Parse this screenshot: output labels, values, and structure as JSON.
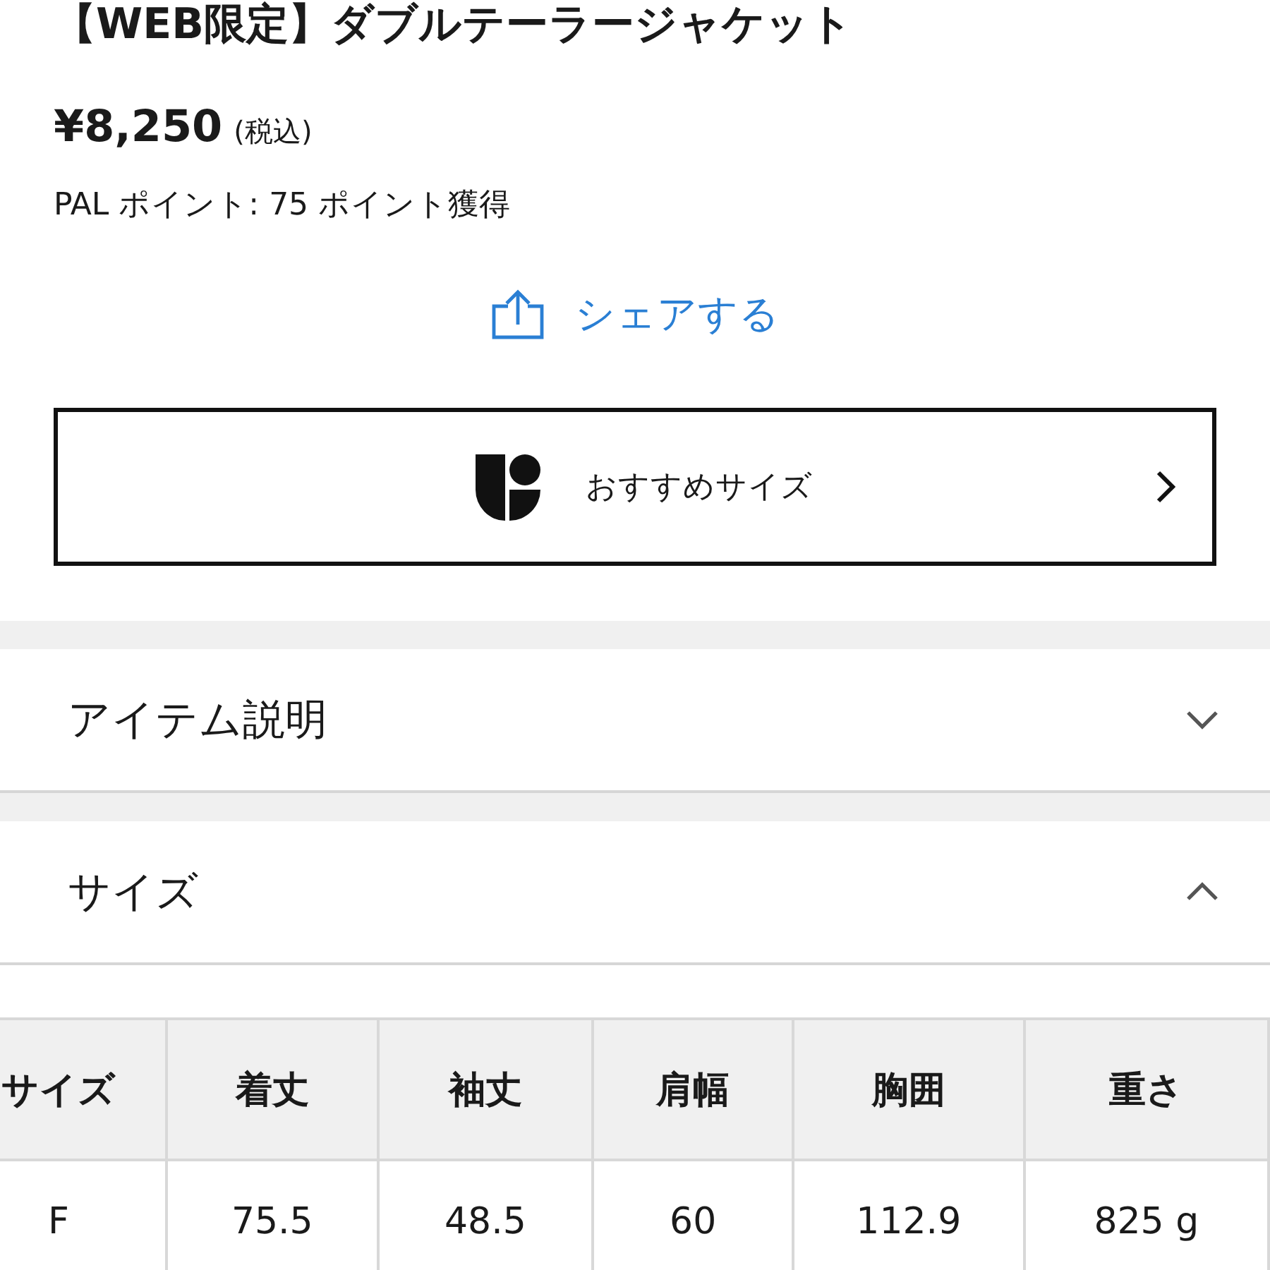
{
  "product": {
    "title": "【WEB限定】ダブルテーラージャケット",
    "price": "¥8,250",
    "tax_note": "(税込)",
    "points": "PAL ポイント: 75 ポイント獲得"
  },
  "share_button": {
    "label": "シェアする"
  },
  "recommend_size_button": {
    "label": "おすすめサイズ"
  },
  "accordions": [
    {
      "label": "アイテム説明",
      "expanded": false
    },
    {
      "label": "サイズ",
      "expanded": true,
      "table": {
        "columns": [
          "サイズ",
          "着丈",
          "袖丈",
          "肩幅",
          "胸囲",
          "重さ"
        ],
        "rows": [
          [
            "F",
            "75.5",
            "48.5",
            "60",
            "112.9",
            "825 g"
          ]
        ]
      }
    }
  ]
}
